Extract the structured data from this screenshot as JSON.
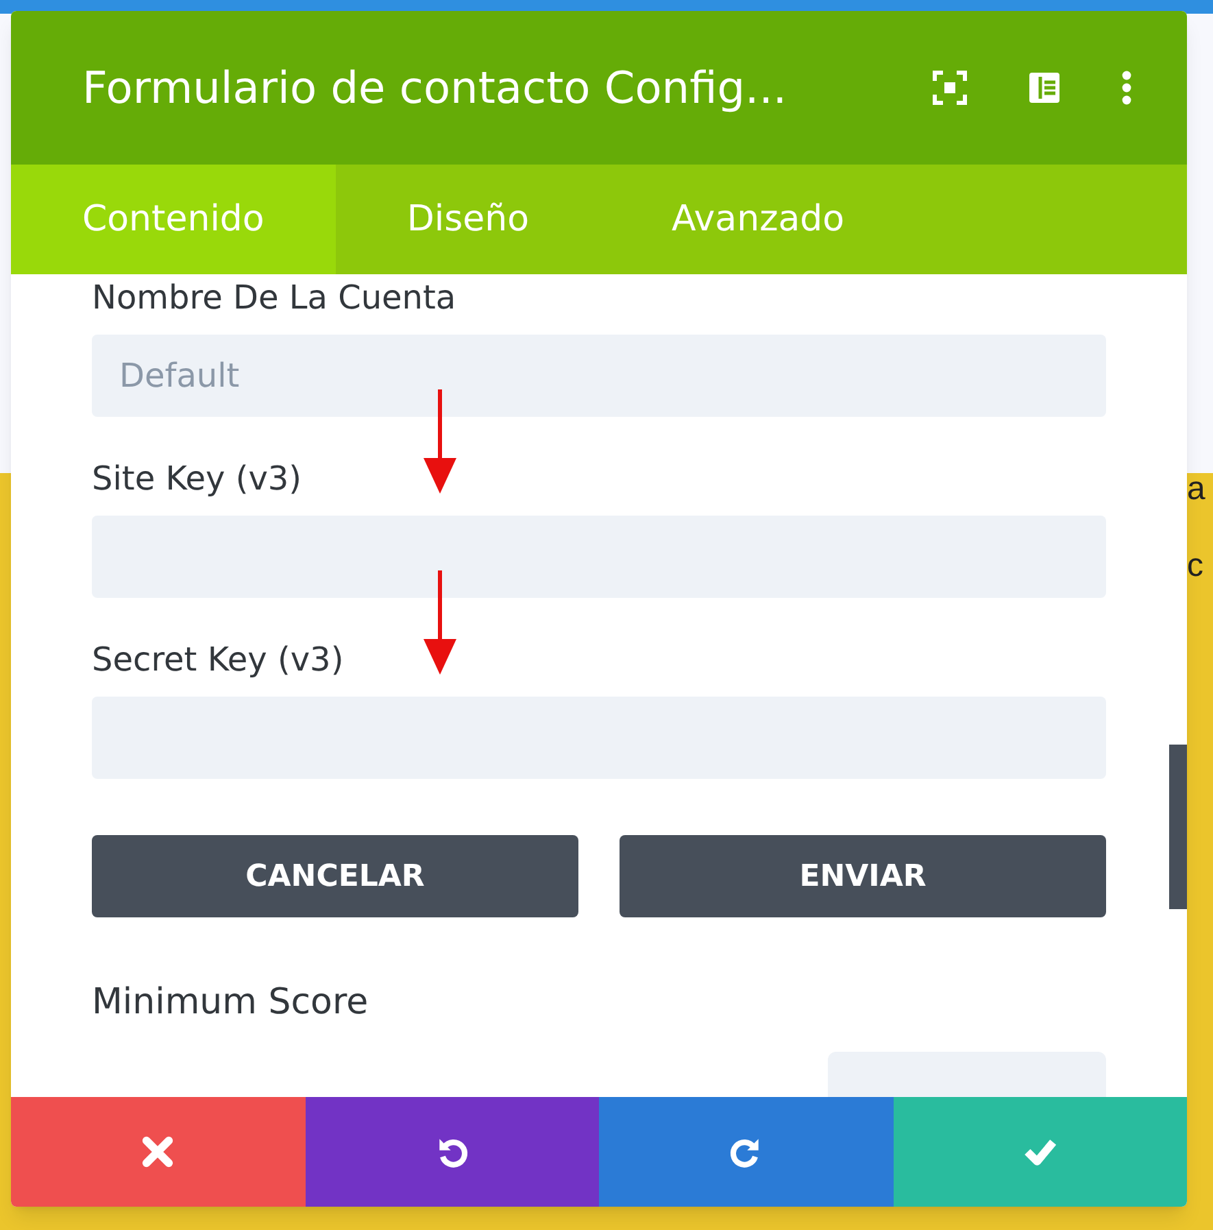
{
  "background": {
    "fragments": [
      "a",
      "c"
    ]
  },
  "modal": {
    "title": "Formulario de contacto Config...",
    "tabs": [
      {
        "label": "Contenido",
        "selected": true
      },
      {
        "label": "Diseño",
        "selected": false
      },
      {
        "label": "Avanzado",
        "selected": false
      }
    ],
    "fields": [
      {
        "kind": "input",
        "label": "Nombre De La Cuenta",
        "placeholder": "Default"
      },
      {
        "kind": "input",
        "label": "Site Key (v3)",
        "annotated": true
      },
      {
        "kind": "input",
        "label": "Secret Key (v3)",
        "annotated": true
      },
      {
        "kind": "buttons",
        "buttons": [
          "CANCELAR",
          "ENVIAR"
        ]
      },
      {
        "kind": "range",
        "label": "Minimum Score"
      }
    ],
    "footer": [
      {
        "kind": "discard"
      },
      {
        "kind": "undo"
      },
      {
        "kind": "redo"
      },
      {
        "kind": "save"
      }
    ]
  }
}
